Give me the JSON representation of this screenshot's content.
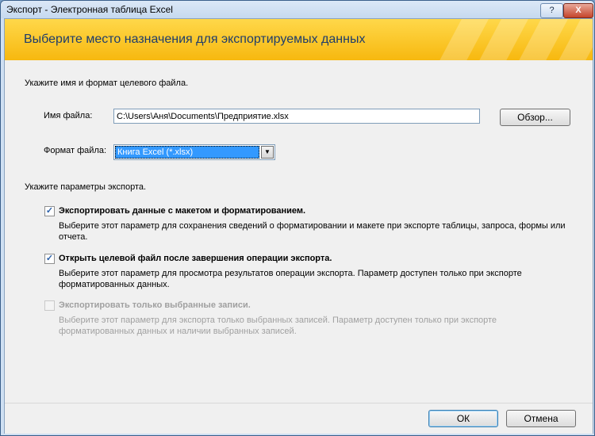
{
  "window": {
    "title": "Экспорт - Электронная таблица Excel",
    "help_label": "?",
    "close_label": "X"
  },
  "banner": {
    "title": "Выберите место назначения для экспортируемых данных"
  },
  "file_section": {
    "heading": "Укажите имя и формат целевого файла.",
    "file_name_label": "Имя файла:",
    "file_name_value": "C:\\Users\\Аня\\Documents\\Предприятие.xlsx",
    "browse_button": "Обзор...",
    "format_label": "Формат файла:",
    "format_value": "Книга Excel (*.xlsx)"
  },
  "options": {
    "heading": "Укажите параметры экспорта.",
    "items": [
      {
        "label": "Экспортировать данные с макетом и форматированием.",
        "description": "Выберите этот параметр для сохранения сведений о форматировании и макете при экспорте таблицы, запроса, формы или отчета.",
        "checked": true,
        "enabled": true
      },
      {
        "label": "Открыть целевой файл после завершения операции экспорта.",
        "description": "Выберите этот параметр для просмотра результатов операции экспорта. Параметр доступен только при экспорте форматированных данных.",
        "checked": true,
        "enabled": true
      },
      {
        "label": "Экспортировать только выбранные записи.",
        "description": "Выберите этот параметр для экспорта только выбранных записей. Параметр доступен только при экспорте форматированных данных и наличии выбранных записей.",
        "checked": false,
        "enabled": false
      }
    ]
  },
  "footer": {
    "ok_button": "ОК",
    "cancel_button": "Отмена"
  },
  "colors": {
    "banner_top": "#ffd84a",
    "banner_bottom": "#f7b80f",
    "banner_text": "#1f3d6b",
    "selection": "#3399ff"
  }
}
